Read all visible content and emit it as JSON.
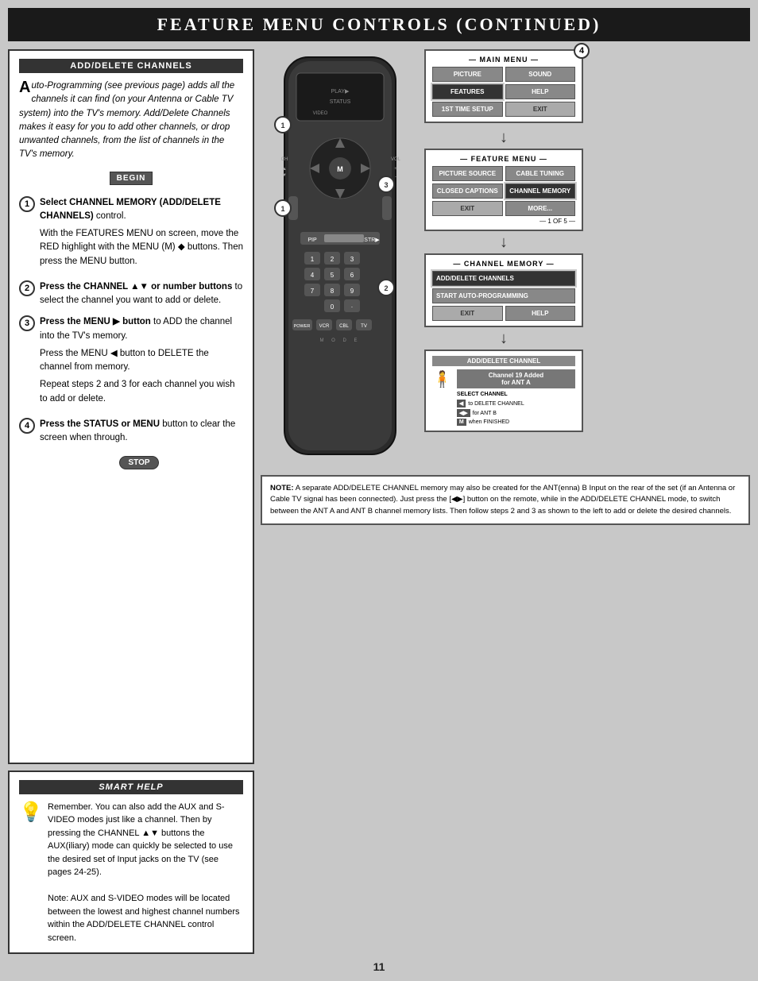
{
  "header": {
    "title": "Feature Menu Controls (Continued)"
  },
  "left_panel": {
    "section_title": "Add/Delete Channels",
    "intro_text": "uto-Programming (see previous page) adds all the channels it can find (on your Antenna or Cable TV system) into the TV's memory. Add/Delete Channels makes it easy for you to add other channels, or drop unwanted channels, from the list of channels in the TV's memory.",
    "begin_badge": "BEGIN",
    "steps": [
      {
        "num": "1",
        "bold": "Select CHANNEL MEMORY (ADD/DELETE CHANNELS)",
        "text": " control.\n\nWith the FEATURES MENU on screen, move the RED highlight with the MENU (M) ◆ buttons. Then press the MENU button."
      },
      {
        "num": "2",
        "bold": "Press the CHANNEL ▲▼ or number buttons",
        "text": " to select the channel you want to add or delete."
      },
      {
        "num": "3",
        "bold": "Press the MENU ▶ button",
        "text": " to ADD the channel into the TV's memory.\n\nPress the MENU ◀ button to DELETE the channel from memory.\n\nRepeat steps 2 and 3 for each channel you wish to add or delete."
      },
      {
        "num": "4",
        "bold": "Press the STATUS or MENU",
        "text": " button to clear the screen when through."
      }
    ],
    "stop_badge": "STOP"
  },
  "smart_help": {
    "title": "Smart Help",
    "text": "Remember. You can also add the AUX and S-VIDEO modes just like a channel. Then by pressing the CHANNEL ▲▼ buttons the AUX(iliary) mode can quickly be selected to use the desired set of Input jacks on the TV (see pages 24-25).\n\nNote: AUX and S-VIDEO modes will be located between the lowest and highest channel numbers within the ADD/DELETE CHANNEL control screen."
  },
  "main_menu": {
    "label": "— MAIN MENU —",
    "buttons": [
      "PICTURE",
      "SOUND",
      "FEATURES",
      "HELP",
      "1ST TIME SETUP",
      "EXIT"
    ]
  },
  "feature_menu": {
    "label": "— FEATURE MENU —",
    "buttons": [
      "PICTURE SOURCE",
      "CABLE TUNING",
      "CLOSED CAPTIONS",
      "CHANNEL MEMORY",
      "EXIT",
      "MORE...",
      "1 OF 5"
    ]
  },
  "channel_memory": {
    "label": "— CHANNEL MEMORY —",
    "buttons": [
      "ADD/DELETE CHANNELS",
      "START AUTO-PROGRAMMING",
      "EXIT",
      "HELP"
    ]
  },
  "add_delete_channel": {
    "label": "ADD/DELETE CHANNEL",
    "status": "Channel 19 Added for ANT A",
    "select_label": "SELECT CHANNEL",
    "options": [
      "to DELETE CHANNEL",
      "for ANT B",
      "when FINISHED"
    ],
    "option_icons": [
      "◀",
      "◀▶",
      "M"
    ]
  },
  "note": {
    "label": "NOTE:",
    "text": "A separate ADD/DELETE CHANNEL memory may also be created for the ANT(enna) B Input on the rear of the set (if an Antenna or Cable TV signal has been connected). Just press the [◀▶] button on the remote, while in the ADD/DELETE CHANNEL mode, to switch between the ANT A and ANT B channel memory lists. Then follow steps 2 and 3 as shown to the left to add or delete the desired channels."
  },
  "page_number": "11"
}
